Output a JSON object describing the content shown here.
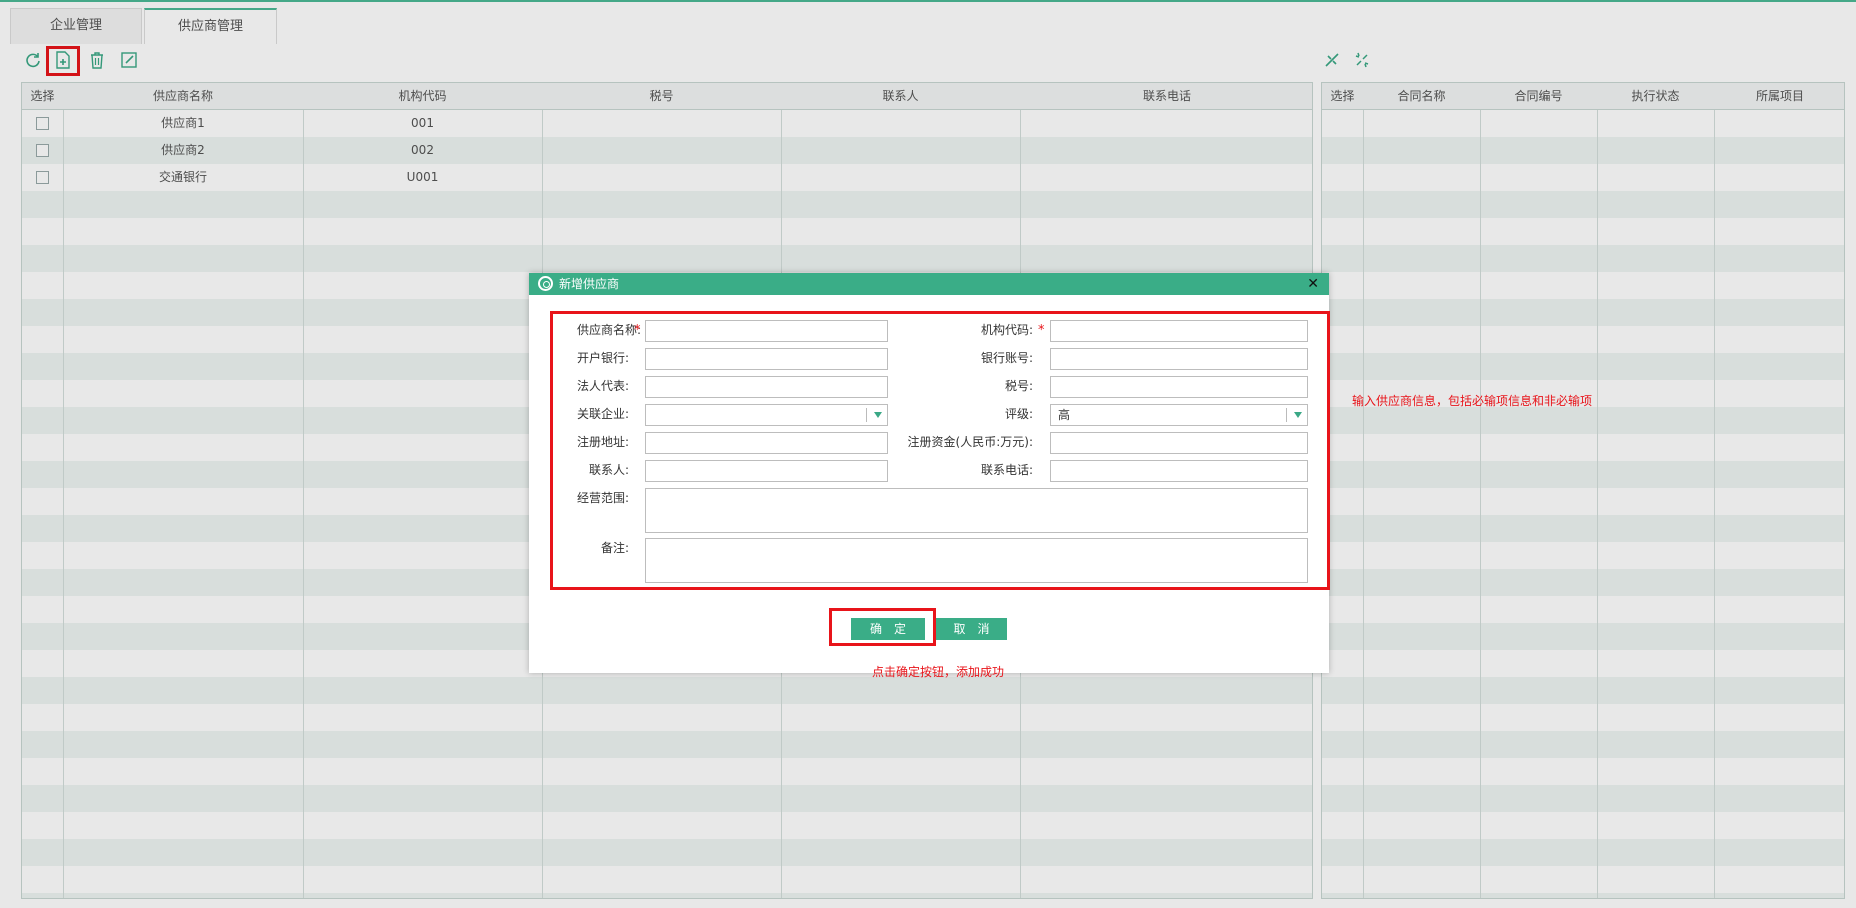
{
  "tabs": [
    "企业管理",
    "供应商管理"
  ],
  "toolbar": {
    "left_icons": [
      "refresh-icon",
      "add-icon",
      "delete-icon",
      "edit-icon"
    ],
    "right_icons": [
      "link-icon",
      "unlink-icon"
    ]
  },
  "supplier_grid": {
    "columns": [
      "选择",
      "供应商名称",
      "机构代码",
      "税号",
      "联系人",
      "联系电话"
    ],
    "rows": [
      {
        "name": "供应商1",
        "code": "001"
      },
      {
        "name": "供应商2",
        "code": "002"
      },
      {
        "name": "交通银行",
        "code": "U001"
      }
    ]
  },
  "contract_grid": {
    "columns": [
      "选择",
      "合同名称",
      "合同编号",
      "执行状态",
      "所属项目"
    ]
  },
  "dialog": {
    "title": "新增供应商",
    "close": "✕",
    "fields": {
      "supplier_name": "供应商名称:",
      "org_code": "机构代码:",
      "bank": "开户银行:",
      "bank_account": "银行账号:",
      "legal_rep": "法人代表:",
      "tax_no": "税号:",
      "related_company": "关联企业:",
      "rating": "评级:",
      "reg_address": "注册地址:",
      "reg_capital": "注册资金(人民币:万元):",
      "contact": "联系人:",
      "contact_phone": "联系电话:",
      "business_scope": "经营范围:",
      "remark": "备注:"
    },
    "required_mark": "*",
    "rating_value": "高",
    "confirm_label": "确定",
    "cancel_label": "取消"
  },
  "annotations": {
    "form_note": "输入供应商信息，包括必输项信息和非必输项",
    "confirm_note": "点击确定按钮，添加成功"
  },
  "colors": {
    "accent": "#3aad87",
    "highlight": "#e8141a"
  }
}
